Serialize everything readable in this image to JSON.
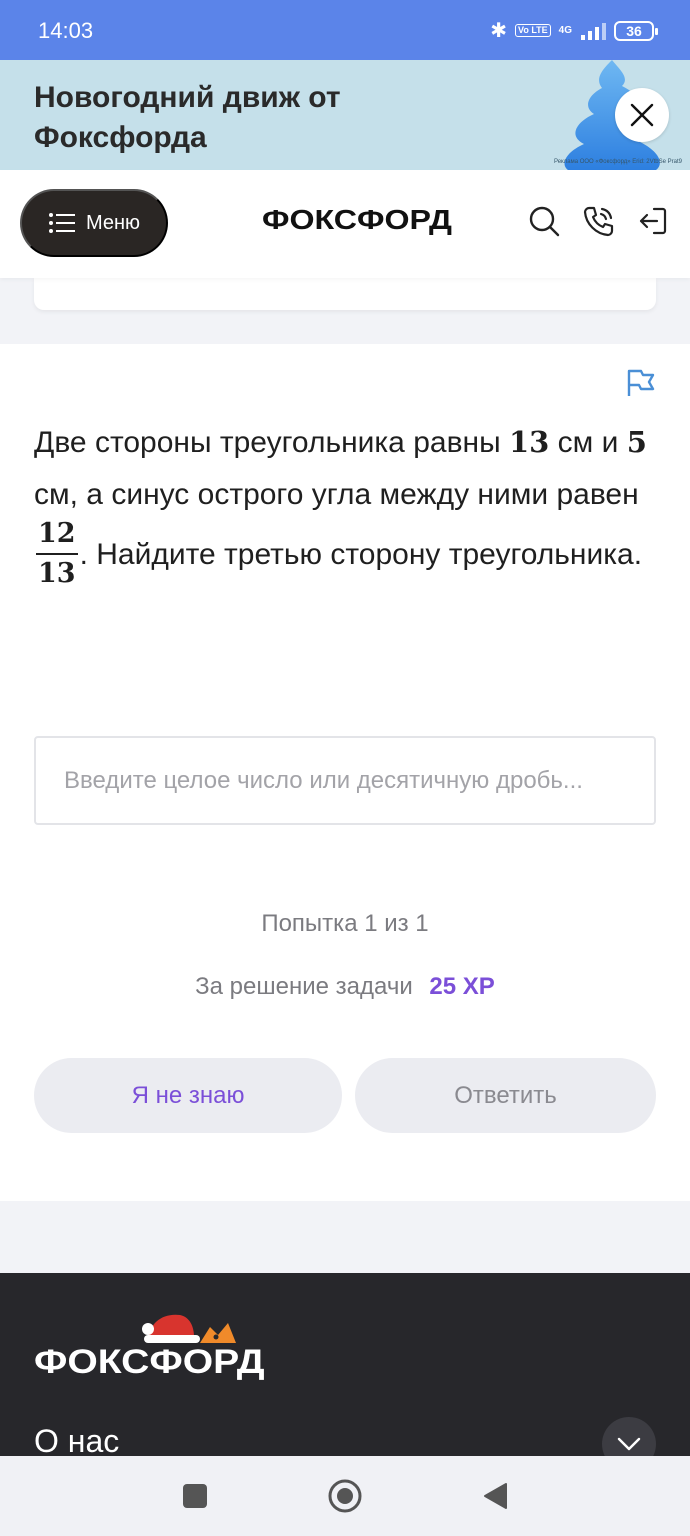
{
  "status_bar": {
    "time": "14:03",
    "network": "4G",
    "volte": "Vo LTE",
    "battery": "36"
  },
  "promo": {
    "title": "Новогодний движ от Фоксфорда",
    "ad_note": "Реклама ООО «Фоксфорд» Erid: 2VtbSe Prat9"
  },
  "header": {
    "menu_label": "Меню",
    "logo": "ФОКСФОРД"
  },
  "task": {
    "question_parts": {
      "p1": "Две стороны треугольника равны ",
      "a": "13",
      "p2": " см и ",
      "b": "5",
      "p3": " см, а синус острого угла между ними равен ",
      "frac_num": "12",
      "frac_den": "13",
      "p4": ". Найдите третью сторону треугольника."
    },
    "answer_placeholder": "Введите целое число или десятичную дробь...",
    "attempts": "Попытка 1 из 1",
    "reward_label": "За решение задачи",
    "reward_value": "25 XP",
    "dont_know_label": "Я не знаю",
    "answer_label": "Ответить"
  },
  "footer": {
    "logo": "ФОКСФОРД",
    "about": "О нас"
  },
  "colors": {
    "status_bar": "#5b84e9",
    "promo_bg": "#c5e0ea",
    "accent_purple": "#7b4fd8",
    "flag_blue": "#4a8fd6",
    "footer_bg": "#27272b"
  },
  "icons": {
    "menu": "list-icon",
    "search": "search-icon",
    "phone": "phone-icon",
    "login": "login-icon",
    "close": "close-icon",
    "flag": "flag-icon",
    "chevron": "chevron-down-icon"
  }
}
